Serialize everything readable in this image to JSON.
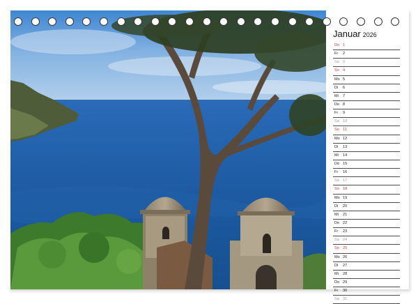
{
  "calendar": {
    "month": "Januar",
    "year": "2026",
    "days": [
      {
        "dn": "Do",
        "num": "1",
        "type": "holiday"
      },
      {
        "dn": "Fr",
        "num": "2",
        "type": "weekday"
      },
      {
        "dn": "Sa",
        "num": "3",
        "type": "sat"
      },
      {
        "dn": "So",
        "num": "4",
        "type": "sun"
      },
      {
        "dn": "Mo",
        "num": "5",
        "type": "weekday"
      },
      {
        "dn": "Di",
        "num": "6",
        "type": "weekday"
      },
      {
        "dn": "Mi",
        "num": "7",
        "type": "weekday"
      },
      {
        "dn": "Do",
        "num": "8",
        "type": "weekday"
      },
      {
        "dn": "Fr",
        "num": "9",
        "type": "weekday"
      },
      {
        "dn": "Sa",
        "num": "10",
        "type": "sat"
      },
      {
        "dn": "So",
        "num": "11",
        "type": "sun"
      },
      {
        "dn": "Mo",
        "num": "12",
        "type": "weekday"
      },
      {
        "dn": "Di",
        "num": "13",
        "type": "weekday"
      },
      {
        "dn": "Mi",
        "num": "14",
        "type": "weekday"
      },
      {
        "dn": "Do",
        "num": "15",
        "type": "weekday"
      },
      {
        "dn": "Fr",
        "num": "16",
        "type": "weekday"
      },
      {
        "dn": "Sa",
        "num": "17",
        "type": "sat"
      },
      {
        "dn": "So",
        "num": "18",
        "type": "sun"
      },
      {
        "dn": "Mo",
        "num": "19",
        "type": "weekday"
      },
      {
        "dn": "Di",
        "num": "20",
        "type": "weekday"
      },
      {
        "dn": "Mi",
        "num": "21",
        "type": "weekday"
      },
      {
        "dn": "Do",
        "num": "22",
        "type": "weekday"
      },
      {
        "dn": "Fr",
        "num": "23",
        "type": "weekday"
      },
      {
        "dn": "Sa",
        "num": "24",
        "type": "sat"
      },
      {
        "dn": "So",
        "num": "25",
        "type": "sun"
      },
      {
        "dn": "Mo",
        "num": "26",
        "type": "weekday"
      },
      {
        "dn": "Di",
        "num": "27",
        "type": "weekday"
      },
      {
        "dn": "Mi",
        "num": "28",
        "type": "weekday"
      },
      {
        "dn": "Do",
        "num": "29",
        "type": "weekday"
      },
      {
        "dn": "Fr",
        "num": "30",
        "type": "weekday"
      },
      {
        "dn": "Sa",
        "num": "31",
        "type": "sat"
      }
    ]
  },
  "colors": {
    "sun": "#d23b2d",
    "sat": "#9a9a9a",
    "weekday": "#222222",
    "sea": "#1f5fa8",
    "sky": "#7fb0e0"
  }
}
